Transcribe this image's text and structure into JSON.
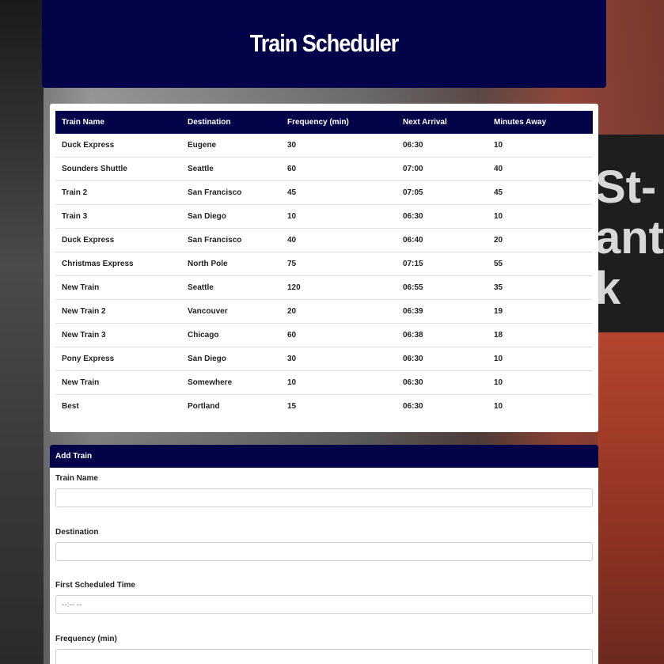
{
  "app": {
    "title": "Train Scheduler"
  },
  "background": {
    "sign_text": "St-\nant\nk"
  },
  "schedule": {
    "columns": [
      "Train Name",
      "Destination",
      "Frequency (min)",
      "Next Arrival",
      "Minutes Away"
    ],
    "rows": [
      [
        "Duck Express",
        "Eugene",
        "30",
        "06:30",
        "10"
      ],
      [
        "Sounders Shuttle",
        "Seattle",
        "60",
        "07:00",
        "40"
      ],
      [
        "Train 2",
        "San Francisco",
        "45",
        "07:05",
        "45"
      ],
      [
        "Train 3",
        "San Diego",
        "10",
        "06:30",
        "10"
      ],
      [
        "Duck Express",
        "San Francisco",
        "40",
        "06:40",
        "20"
      ],
      [
        "Christmas Express",
        "North Pole",
        "75",
        "07:15",
        "55"
      ],
      [
        "New Train",
        "Seattle",
        "120",
        "06:55",
        "35"
      ],
      [
        "New Train 2",
        "Vancouver",
        "20",
        "06:39",
        "19"
      ],
      [
        "New Train 3",
        "Chicago",
        "60",
        "06:38",
        "18"
      ],
      [
        "Pony Express",
        "San Diego",
        "30",
        "06:30",
        "10"
      ],
      [
        "New Train",
        "Somewhere",
        "10",
        "06:30",
        "10"
      ],
      [
        "Best",
        "Portland",
        "15",
        "06:30",
        "10"
      ]
    ]
  },
  "add_train": {
    "title": "Add Train",
    "train_name": {
      "label": "Train Name",
      "value": ""
    },
    "destination": {
      "label": "Destination",
      "value": ""
    },
    "first_time": {
      "label": "First Scheduled Time",
      "placeholder": "--:-- --"
    },
    "frequency": {
      "label": "Frequency (min)",
      "value": ""
    }
  },
  "colors": {
    "navy": "#03034a",
    "panel": "#ffffff"
  }
}
